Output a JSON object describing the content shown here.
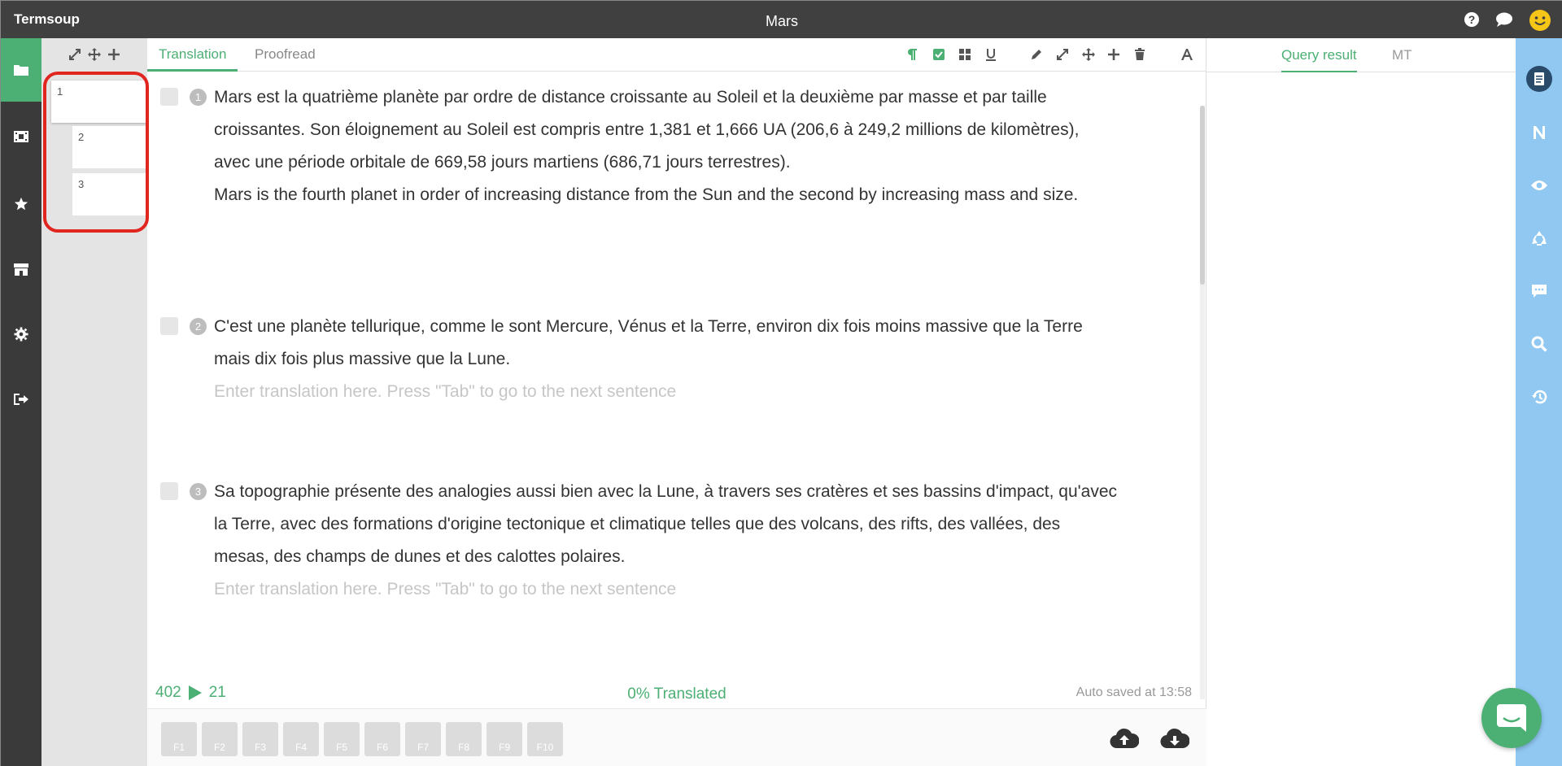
{
  "app": {
    "name": "Termsoup",
    "title": "Mars"
  },
  "topbar": {
    "icons": [
      "help-icon",
      "chat-icon",
      "smiley-avatar-icon"
    ]
  },
  "leftbar": {
    "items": [
      "folder-icon",
      "film-icon",
      "star-icon",
      "store-icon",
      "gear-icon",
      "sign-out-icon"
    ]
  },
  "thumbs": {
    "pages": [
      "1",
      "2",
      "3"
    ]
  },
  "editor": {
    "tabs": [
      "Translation",
      "Proofread"
    ],
    "toolbar_icons": [
      "paragraph-icon",
      "check-square-icon",
      "grid-icon",
      "underline-icon",
      "pencil-icon",
      "collapse-icon",
      "move-icon",
      "plus-icon",
      "trash-icon",
      "font-icon"
    ],
    "segments": [
      {
        "num": "1",
        "source": "Mars est la quatrième planète par ordre de distance croissante au Soleil et la deuxième par masse et par taille croissantes. Son éloignement au Soleil est compris entre 1,381 et 1,666 UA (206,6 à 249,2 millions de kilomètres), avec une période orbitale de 669,58 jours martiens (686,71 jours terrestres).",
        "translation": "Mars is the fourth planet in order of increasing distance from the Sun and the second by increasing mass and size."
      },
      {
        "num": "2",
        "source": "C'est une planète tellurique, comme le sont Mercure, Vénus et la Terre, environ dix fois moins massive que la Terre mais dix fois plus massive que la Lune.",
        "placeholder": "Enter translation here. Press \"Tab\" to go to the next sentence"
      },
      {
        "num": "3",
        "source": "Sa topographie présente des analogies aussi bien avec la Lune, à travers ses cratères et ses bassins d'impact, qu'avec la Terre, avec des formations d'origine tectonique et climatique telles que des volcans, des rifts, des vallées, des mesas, des champs de dunes et des calottes polaires.",
        "placeholder": "Enter translation here. Press \"Tab\" to go to the next sentence"
      }
    ],
    "status": {
      "word_count": "402",
      "sentence_count": "21",
      "progress": "0% Translated",
      "autosave": "Auto saved at 13:58"
    },
    "fkeys": [
      "F1",
      "F2",
      "F3",
      "F4",
      "F5",
      "F6",
      "F7",
      "F8",
      "F9",
      "F10"
    ]
  },
  "query": {
    "tabs": [
      "Query result",
      "MT"
    ]
  },
  "rightbar": {
    "items": [
      "notebook-icon",
      "n-letter-icon",
      "eye-icon",
      "recycle-icon",
      "comment-icon",
      "search-icon",
      "history-icon"
    ]
  },
  "colors": {
    "accent": "#4caf74",
    "topbar": "#404040",
    "sidebar": "#3a3a3a",
    "rightbar": "#90c8f2",
    "highlight": "#e0261e"
  }
}
